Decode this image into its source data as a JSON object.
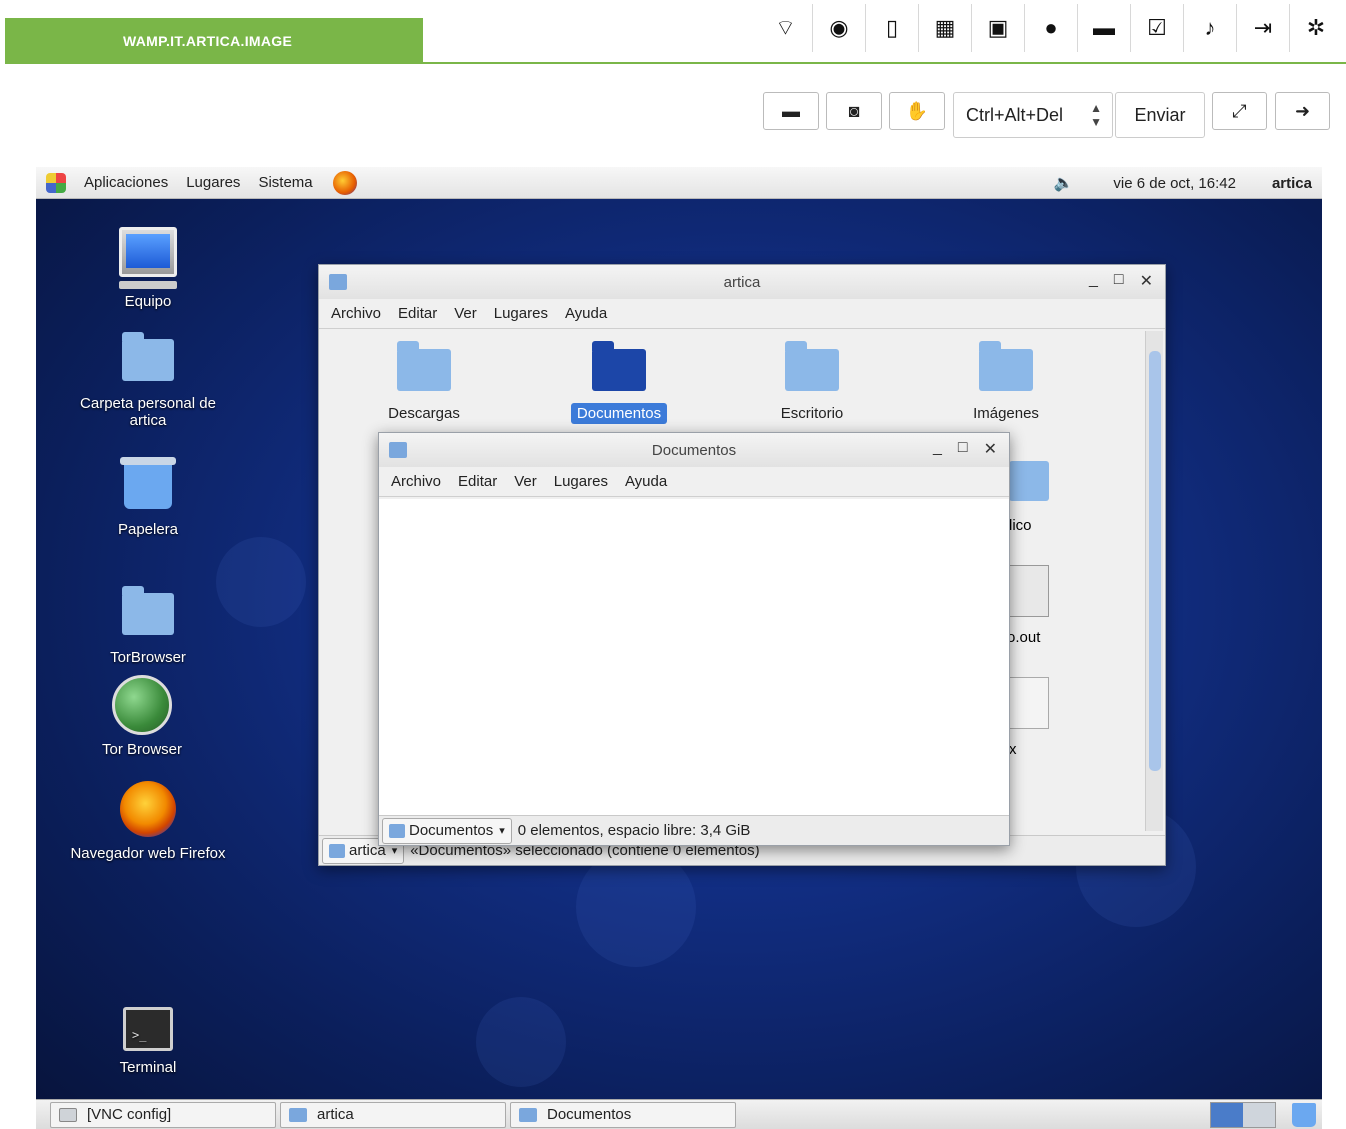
{
  "header": {
    "title": "WAMP.IT.ARTICA.IMAGE",
    "icons": [
      "wifi-icon",
      "eye-icon",
      "bookmark-icon",
      "chart-icon",
      "calendar-icon",
      "location-icon",
      "folder-icon",
      "checklist-icon",
      "bell-icon",
      "logout-icon",
      "gear-icon"
    ]
  },
  "vnc_toolbar": {
    "keys_value": "Ctrl+Alt+Del",
    "send_label": "Enviar"
  },
  "panel": {
    "menu": [
      "Aplicaciones",
      "Lugares",
      "Sistema"
    ],
    "clock": "vie  6 de oct, 16:42",
    "user": "artica"
  },
  "desktop_icons": [
    {
      "label": "Equipo"
    },
    {
      "label": "Carpeta personal de artica"
    },
    {
      "label": "Papelera"
    },
    {
      "label": "TorBrowser"
    },
    {
      "label": "Tor Browser"
    },
    {
      "label": "Navegador web Firefox"
    },
    {
      "label": "Terminal"
    }
  ],
  "win_artica": {
    "title": "artica",
    "menu": [
      "Archivo",
      "Editar",
      "Ver",
      "Lugares",
      "Ayuda"
    ],
    "items": [
      "Descargas",
      "Documentos",
      "Escritorio",
      "Imágenes"
    ],
    "partial_labels": [
      "lico",
      "o.out",
      "x"
    ],
    "location": "artica",
    "status": "«Documentos» seleccionado (contiene 0 elementos)"
  },
  "win_documentos": {
    "title": "Documentos",
    "menu": [
      "Archivo",
      "Editar",
      "Ver",
      "Lugares",
      "Ayuda"
    ],
    "location": "Documentos",
    "status": "0 elementos, espacio libre: 3,4 GiB"
  },
  "taskbar": {
    "tasks": [
      "[VNC config]",
      "artica",
      "Documentos"
    ]
  }
}
